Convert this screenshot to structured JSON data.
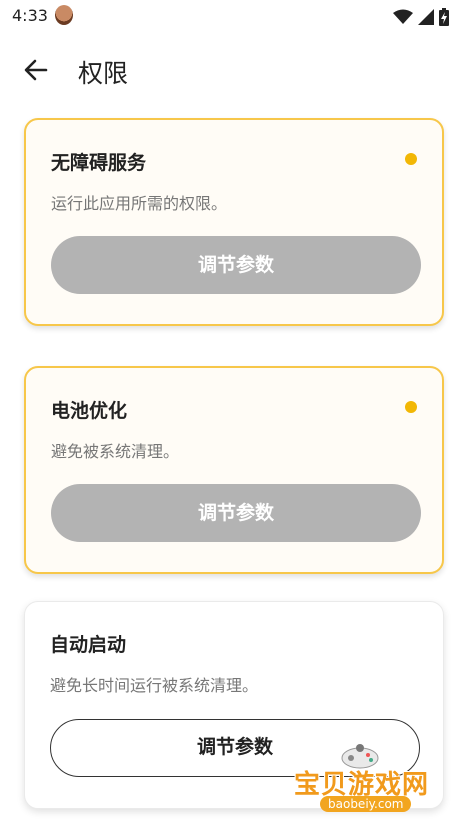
{
  "status_bar": {
    "time": "4:33"
  },
  "header": {
    "title": "权限",
    "back_icon": "arrow-left-icon"
  },
  "cards": [
    {
      "title": "无障碍服务",
      "description": "运行此应用所需的权限。",
      "button_label": "调节参数",
      "status": "pending",
      "dot_color": "#f2b705"
    },
    {
      "title": "电池优化",
      "description": "避免被系统清理。",
      "button_label": "调节参数",
      "status": "pending",
      "dot_color": "#f2b705"
    },
    {
      "title": "自动启动",
      "description": "避免长时间运行被系统清理。",
      "button_label": "调节参数",
      "status": "granted"
    }
  ],
  "watermark": {
    "text": "宝贝游戏网",
    "url": "baobeiy.com"
  },
  "colors": {
    "accent": "#f7c74a",
    "dot": "#f2b705",
    "button_disabled": "#b3b3b3"
  }
}
